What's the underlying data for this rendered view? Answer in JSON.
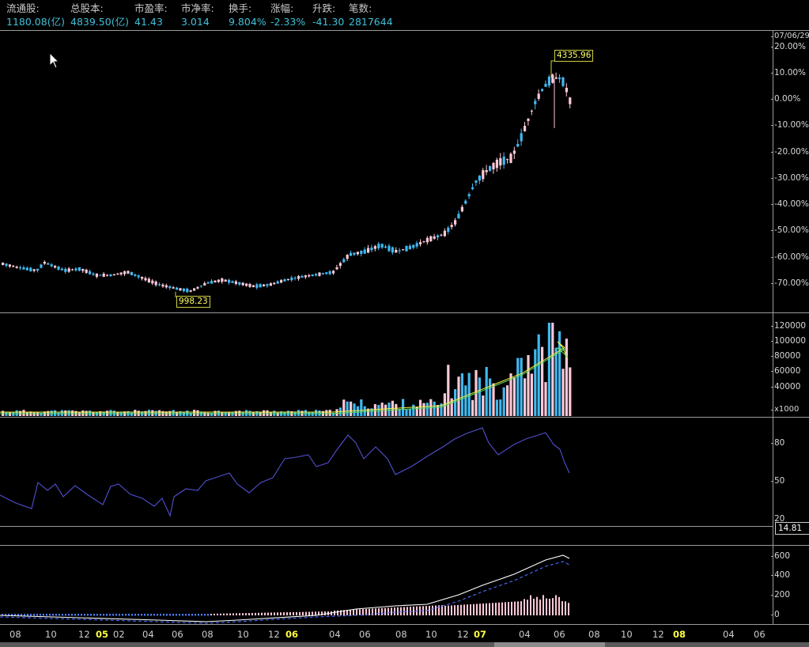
{
  "header": {
    "fields": [
      {
        "label": "流通股:",
        "value": "1180.08(亿)"
      },
      {
        "label": "总股本:",
        "value": "4839.50(亿)"
      },
      {
        "label": "市盈率:",
        "value": "41.43"
      },
      {
        "label": "市净率:",
        "value": "3.014"
      },
      {
        "label": "换手:",
        "value": "9.804%"
      },
      {
        "label": "涨幅:",
        "value": "-2.33%"
      },
      {
        "label": "升跌:",
        "value": "-41.30"
      },
      {
        "label": "笔数:",
        "value": "2817644"
      }
    ]
  },
  "price_panel": {
    "date_label": "07/06/29",
    "axis_ticks": [
      "20.00%",
      "10.00%",
      "0.00%",
      "-10.00%",
      "-20.00%",
      "-30.00%",
      "-40.00%",
      "-50.00%",
      "-60.00%",
      "-70.00%"
    ],
    "high_label": "4335.96",
    "low_label": "998.23"
  },
  "volume_panel": {
    "axis_ticks": [
      "120000",
      "100000",
      "80000",
      "60000",
      "40000"
    ],
    "unit": "x1000"
  },
  "oscillator_panel": {
    "axis_ticks": [
      "80",
      "50",
      "20"
    ],
    "current_value": "14.81"
  },
  "macd_panel": {
    "axis_ticks": [
      "600",
      "400",
      "200",
      "0"
    ]
  },
  "x_axis": {
    "labels": [
      {
        "text": "08",
        "year": false
      },
      {
        "text": "10",
        "year": false
      },
      {
        "text": "12",
        "year": false
      },
      {
        "text": "05",
        "year": true
      },
      {
        "text": "02",
        "year": false
      },
      {
        "text": "04",
        "year": false
      },
      {
        "text": "06",
        "year": false
      },
      {
        "text": "08",
        "year": false
      },
      {
        "text": "10",
        "year": false
      },
      {
        "text": "12",
        "year": false
      },
      {
        "text": "06",
        "year": true
      },
      {
        "text": "04",
        "year": false
      },
      {
        "text": "06",
        "year": false
      },
      {
        "text": "08",
        "year": false
      },
      {
        "text": "10",
        "year": false
      },
      {
        "text": "12",
        "year": false
      },
      {
        "text": "07",
        "year": true
      },
      {
        "text": "04",
        "year": false
      },
      {
        "text": "06",
        "year": false
      },
      {
        "text": "08",
        "year": false
      },
      {
        "text": "10",
        "year": false
      },
      {
        "text": "12",
        "year": false
      },
      {
        "text": "08",
        "year": true
      },
      {
        "text": "04",
        "year": false
      },
      {
        "text": "06",
        "year": false
      }
    ]
  },
  "colors": {
    "up": "#ffc8d8",
    "down": "#40b8f0",
    "ma_yellow": "#f0f040",
    "ma_green": "#60e060",
    "oscillator": "#5050d0",
    "macd_dif": "#ffffff",
    "macd_dea": "#4a6cff"
  }
}
